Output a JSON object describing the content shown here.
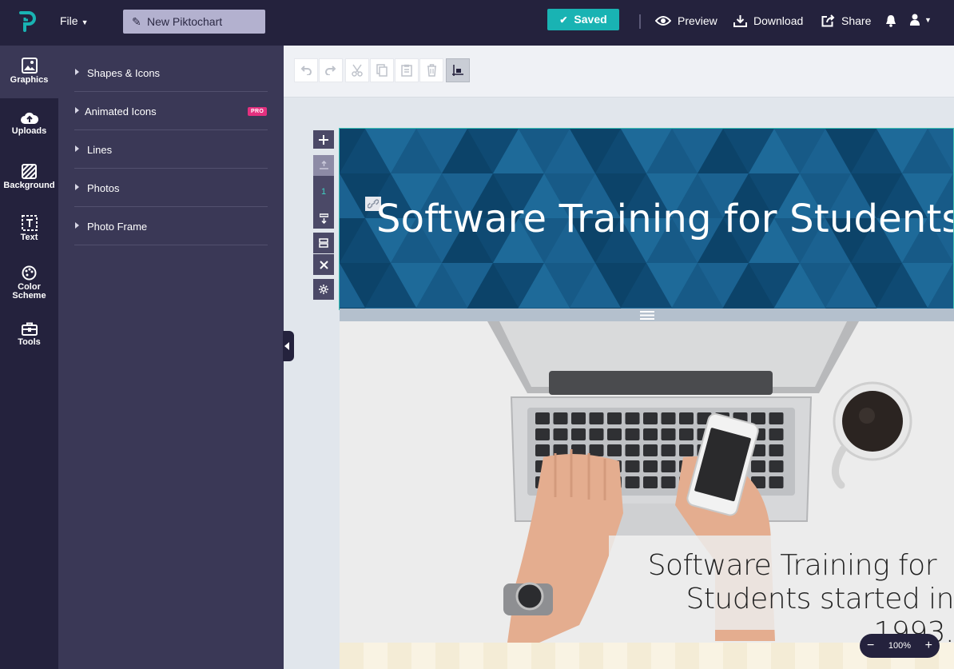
{
  "app": {
    "file_menu": "File",
    "doc_title": "New Piktochart",
    "saved_label": "Saved",
    "actions": {
      "preview": "Preview",
      "download": "Download",
      "share": "Share"
    }
  },
  "rail": [
    {
      "label": "Graphics",
      "icon": "image-icon"
    },
    {
      "label": "Uploads",
      "icon": "cloud-upload-icon"
    },
    {
      "label": "Background",
      "icon": "background-pattern-icon"
    },
    {
      "label": "Text",
      "icon": "text-box-icon"
    },
    {
      "label": "Color Scheme",
      "icon": "palette-icon"
    },
    {
      "label": "Tools",
      "icon": "toolbox-icon"
    }
  ],
  "panel": {
    "items": [
      {
        "label": "Shapes & Icons"
      },
      {
        "label": "Animated Icons",
        "badge": "PRO"
      },
      {
        "label": "Lines"
      },
      {
        "label": "Photos"
      },
      {
        "label": "Photo Frame"
      }
    ]
  },
  "toolbar": {
    "tools": [
      "undo-icon",
      "redo-icon",
      "cut-icon",
      "copy-icon",
      "paste-icon",
      "delete-icon",
      "arrange-icon"
    ]
  },
  "canvas": {
    "block_number": "1",
    "headline": "Software Training for Students",
    "caption_line1": "Software Training for",
    "caption_line2": "Students started in 1993."
  },
  "zoom": {
    "level": "100%",
    "minus": "−",
    "plus": "+"
  },
  "colors": {
    "topbar": "#24223d",
    "panel": "#3a3856",
    "accent": "#19b3b3",
    "pro_badge": "#e4307f",
    "header_block": "#13527d"
  }
}
